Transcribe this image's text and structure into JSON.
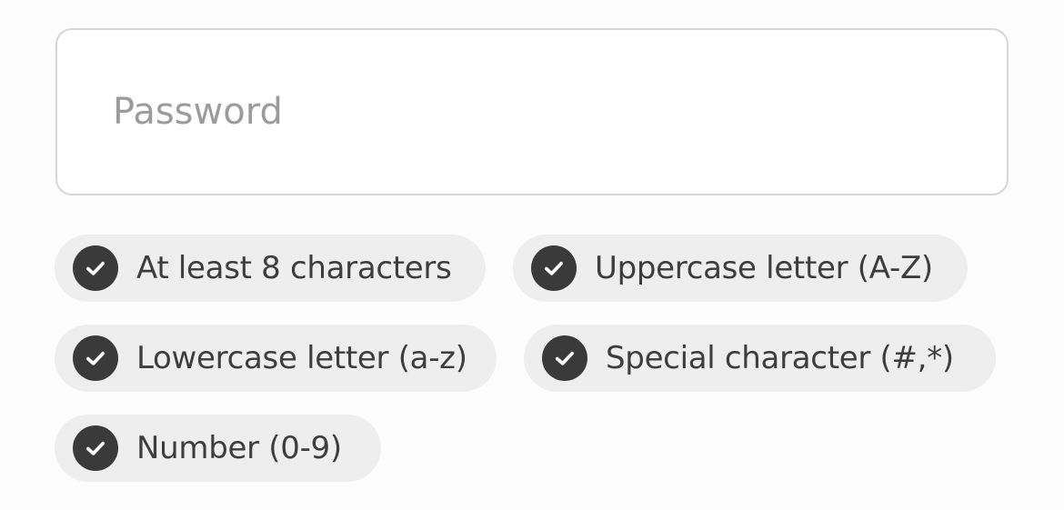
{
  "password": {
    "placeholder": "Password",
    "value": ""
  },
  "requirements": [
    {
      "label": "At least 8 characters",
      "icon": "check-circle-icon",
      "met": true
    },
    {
      "label": "Uppercase letter (A-Z)",
      "icon": "check-circle-icon",
      "met": true
    },
    {
      "label": "Lowercase letter (a-z)",
      "icon": "check-circle-icon",
      "met": true
    },
    {
      "label": "Special character (#,*)",
      "icon": "check-circle-icon",
      "met": true
    },
    {
      "label": "Number (0-9)",
      "icon": "check-circle-icon",
      "met": true
    }
  ],
  "colors": {
    "pill_background": "#eeeeee",
    "check_fill": "#3a3a3a",
    "border": "#d6d6d6",
    "placeholder": "#9b9b9b"
  }
}
